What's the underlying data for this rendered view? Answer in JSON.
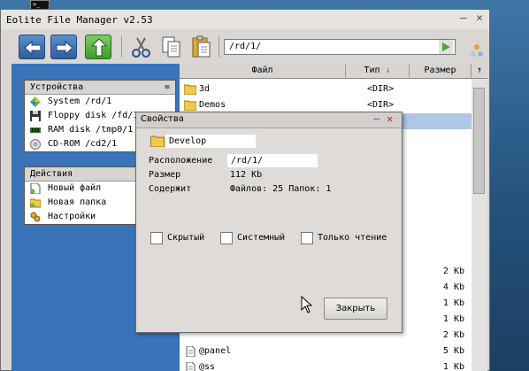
{
  "window": {
    "title": "Eolite File Manager v2.53"
  },
  "toolbar": {
    "path": "/rd/1/"
  },
  "devices": {
    "header": "Устройства",
    "items": [
      {
        "label": "System /rd/1",
        "icon": "system-icon"
      },
      {
        "label": "Floppy disk /fd/1/",
        "icon": "floppy-icon"
      },
      {
        "label": "RAM disk /tmp0/1",
        "icon": "ram-disk-icon"
      },
      {
        "label": "CD-ROM /cd2/1",
        "icon": "cdrom-icon"
      }
    ]
  },
  "actions": {
    "header": "Действия",
    "items": [
      {
        "label": "Новый файл",
        "icon": "new-file-icon"
      },
      {
        "label": "Новая папка",
        "icon": "new-folder-icon"
      },
      {
        "label": "Настройки",
        "icon": "settings-icon"
      }
    ]
  },
  "file_list": {
    "columns": {
      "name": "Файл",
      "type": "Тип",
      "size": "Размер"
    },
    "rows": [
      {
        "name": "3d",
        "type": "<DIR>",
        "size": "",
        "icon": "folder-icon"
      },
      {
        "name": "Demos",
        "type": "<DIR>",
        "size": "",
        "icon": "folder-icon"
      },
      {
        "name": "",
        "type": "",
        "size": "2 Kb",
        "icon": ""
      },
      {
        "name": "",
        "type": "",
        "size": "4 Kb",
        "icon": ""
      },
      {
        "name": "",
        "type": "",
        "size": "1 Kb",
        "icon": ""
      },
      {
        "name": "",
        "type": "",
        "size": "1 Kb",
        "icon": ""
      },
      {
        "name": "",
        "type": "",
        "size": "2 Kb",
        "icon": ""
      },
      {
        "name": "@panel",
        "type": "",
        "size": "5 Kb",
        "icon": "file-icon"
      },
      {
        "name": "@ss",
        "type": "",
        "size": "1 Kb",
        "icon": "file-icon"
      }
    ]
  },
  "dialog": {
    "title": "Свойства",
    "name": "Develop",
    "location_label": "Расположение",
    "location": "/rd/1/",
    "size_label": "Размер",
    "size": "112 Kb",
    "contains_label": "Содержит",
    "contains": "Файлов: 25 Папок: 1",
    "hidden_label": "Скрытый",
    "system_label": "Системный",
    "readonly_label": "Только чтение",
    "close_label": "Закрыть"
  },
  "colors": {
    "selection": "#aec7e6",
    "panel_bg": "#3a73b7",
    "close_red": "#d02020"
  }
}
